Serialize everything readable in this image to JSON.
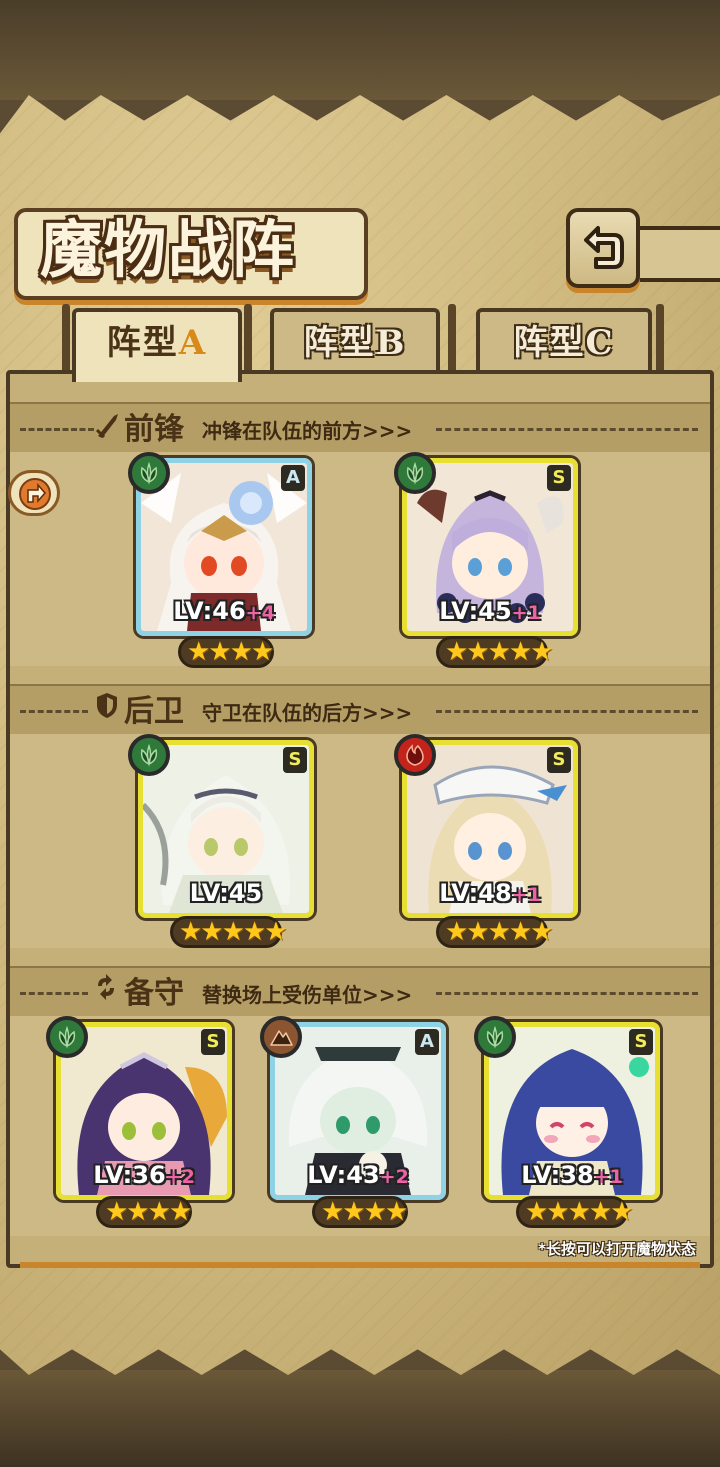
{
  "title": "魔物战阵",
  "tabs": [
    {
      "label": "阵型",
      "letter": "A",
      "active": true
    },
    {
      "label": "阵型",
      "letter": "B",
      "active": false
    },
    {
      "label": "阵型",
      "letter": "C",
      "active": false
    }
  ],
  "sections": {
    "front": {
      "label": "前锋",
      "desc": "冲锋在队伍的前方>>>"
    },
    "back": {
      "label": "后卫",
      "desc": "守卫在队伍的后方>>>"
    },
    "reserve": {
      "label": "备守",
      "desc": "替换场上受伤单位>>>"
    }
  },
  "cards": [
    {
      "rank": "A",
      "element": "grass",
      "level": "LV:46",
      "bonus": "+4",
      "stars": "★★★★",
      "star_count": 4
    },
    {
      "rank": "S",
      "element": "grass",
      "level": "LV:45",
      "bonus": "+1",
      "stars": "★★★★★",
      "star_count": 5
    },
    {
      "rank": "S",
      "element": "grass",
      "level": "LV:45",
      "bonus": "",
      "stars": "★★★★★",
      "star_count": 5
    },
    {
      "rank": "S",
      "element": "fire",
      "level": "LV:48",
      "bonus": "+1",
      "stars": "★★★★★",
      "star_count": 5
    },
    {
      "rank": "S",
      "element": "grass",
      "level": "LV:36",
      "bonus": "+2",
      "stars": "★★★★",
      "star_count": 4
    },
    {
      "rank": "A",
      "element": "earth",
      "level": "LV:43",
      "bonus": "+2",
      "stars": "★★★★",
      "star_count": 4
    },
    {
      "rank": "S",
      "element": "grass",
      "level": "LV:38",
      "bonus": "+1",
      "stars": "★★★★★",
      "star_count": 5
    }
  ],
  "hint": "*长按可以打开魔物状态",
  "icons": {
    "back": "return-arrow-icon",
    "grass": "leaf-element-icon",
    "fire": "flame-element-icon",
    "earth": "mountain-element-icon",
    "front": "sword-icon",
    "back_row": "shield-icon",
    "reserve": "swap-icon"
  },
  "colors": {
    "rank_S_border": "#e7df32",
    "rank_A_border": "#8ed2e6",
    "bonus": "#ec63a6",
    "star": "#ffc81a"
  }
}
